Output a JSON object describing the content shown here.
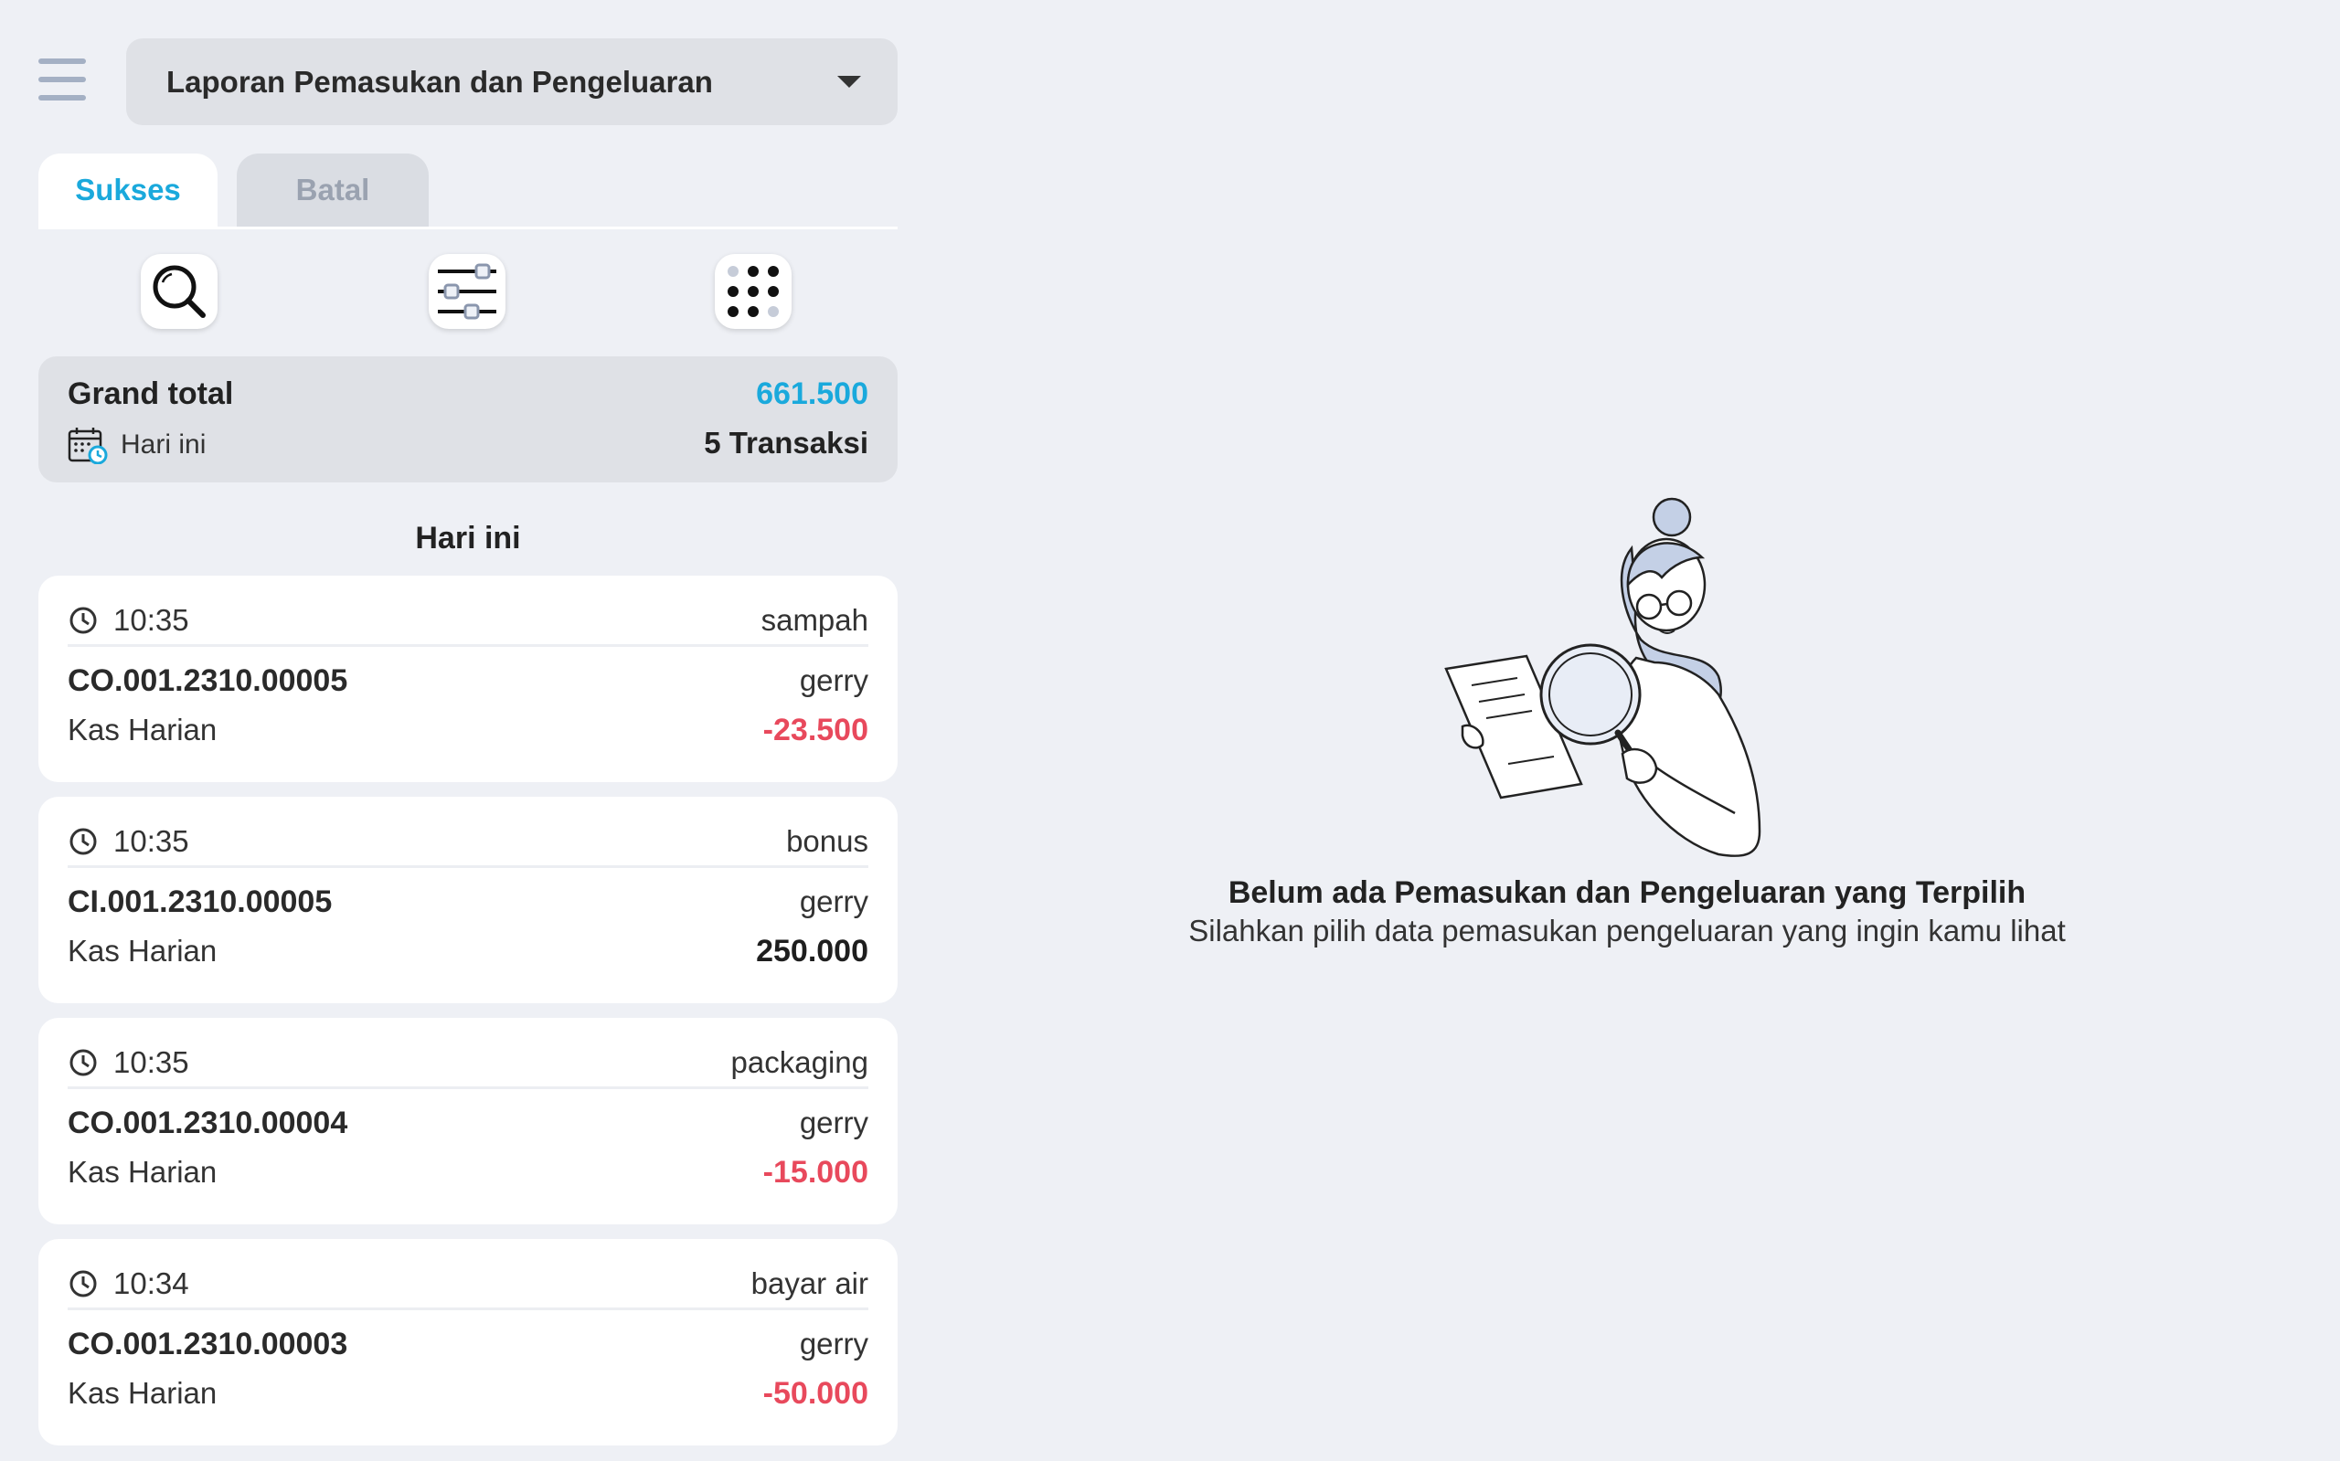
{
  "header": {
    "menu_icon": "hamburger-menu-icon",
    "report_select_label": "Laporan Pemasukan dan Pengeluaran"
  },
  "tabs": [
    {
      "label": "Sukses",
      "active": true
    },
    {
      "label": "Batal",
      "active": false
    }
  ],
  "toolbar": {
    "icons": [
      "search-icon",
      "filter-sliders-icon",
      "dot-grid-icon"
    ]
  },
  "summary": {
    "grand_total_label": "Grand total",
    "grand_total_value": "661.500",
    "period_label": "Hari ini",
    "transaction_count": "5 Transaksi"
  },
  "section_heading": "Hari ini",
  "transactions": [
    {
      "time": "10:35",
      "category": "sampah",
      "code": "CO.001.2310.00005",
      "user": "gerry",
      "account": "Kas Harian",
      "amount": "-23.500"
    },
    {
      "time": "10:35",
      "category": "bonus",
      "code": "CI.001.2310.00005",
      "user": "gerry",
      "account": "Kas Harian",
      "amount": "250.000"
    },
    {
      "time": "10:35",
      "category": "packaging",
      "code": "CO.001.2310.00004",
      "user": "gerry",
      "account": "Kas Harian",
      "amount": "-15.000"
    },
    {
      "time": "10:34",
      "category": "bayar air",
      "code": "CO.001.2310.00003",
      "user": "gerry",
      "account": "Kas Harian",
      "amount": "-50.000"
    }
  ],
  "empty_state": {
    "title": "Belum ada Pemasukan dan Pengeluaran yang Terpilih",
    "subtitle": "Silahkan pilih data pemasukan pengeluaran yang ingin kamu lihat"
  },
  "colors": {
    "accent": "#1aa9dc",
    "negative": "#e8495c",
    "background": "#eef0f5"
  }
}
